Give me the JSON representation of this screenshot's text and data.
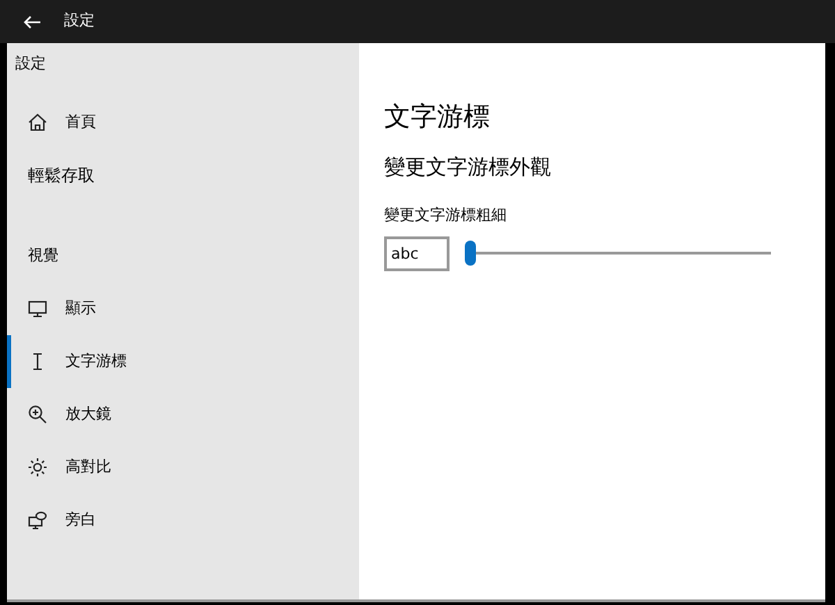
{
  "window": {
    "title": "設定"
  },
  "sidebar": {
    "title": "設定",
    "items": [
      {
        "kind": "nav",
        "label": "首頁",
        "selected": false
      },
      {
        "kind": "header",
        "label": "輕鬆存取"
      },
      {
        "kind": "section",
        "label": "視覺"
      },
      {
        "kind": "nav",
        "label": "顯示",
        "selected": false
      },
      {
        "kind": "nav",
        "label": "文字游標",
        "selected": true
      },
      {
        "kind": "nav",
        "label": "放大鏡",
        "selected": false
      },
      {
        "kind": "nav",
        "label": "高對比",
        "selected": false
      },
      {
        "kind": "nav",
        "label": "旁白",
        "selected": false
      }
    ]
  },
  "content": {
    "title": "文字游標",
    "subtitle": "變更文字游標外觀",
    "setting_label": "變更文字游標粗細",
    "preview": "abc",
    "thickness": {
      "level": 0
    }
  }
}
